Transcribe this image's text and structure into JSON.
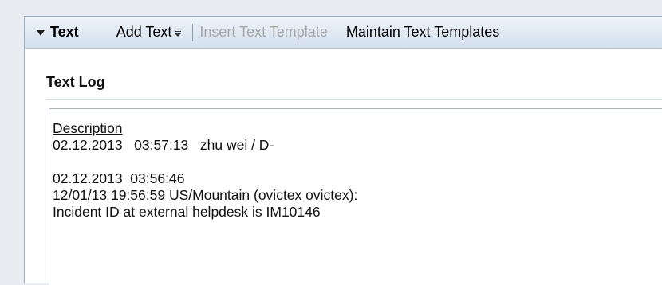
{
  "toolbar": {
    "title": "Text",
    "add_text": "Add Text",
    "insert_template": "Insert Text Template",
    "maintain_templates": "Maintain Text Templates"
  },
  "section": {
    "title": "Text Log"
  },
  "log": {
    "heading": "Description",
    "lines": [
      "02.12.2013   03:57:13   zhu wei / D-",
      "",
      "02.12.2013  03:56:46",
      "12/01/13 19:56:59 US/Mountain (ovictex ovictex):",
      "Incident ID at external helpdesk is IM10146"
    ]
  }
}
